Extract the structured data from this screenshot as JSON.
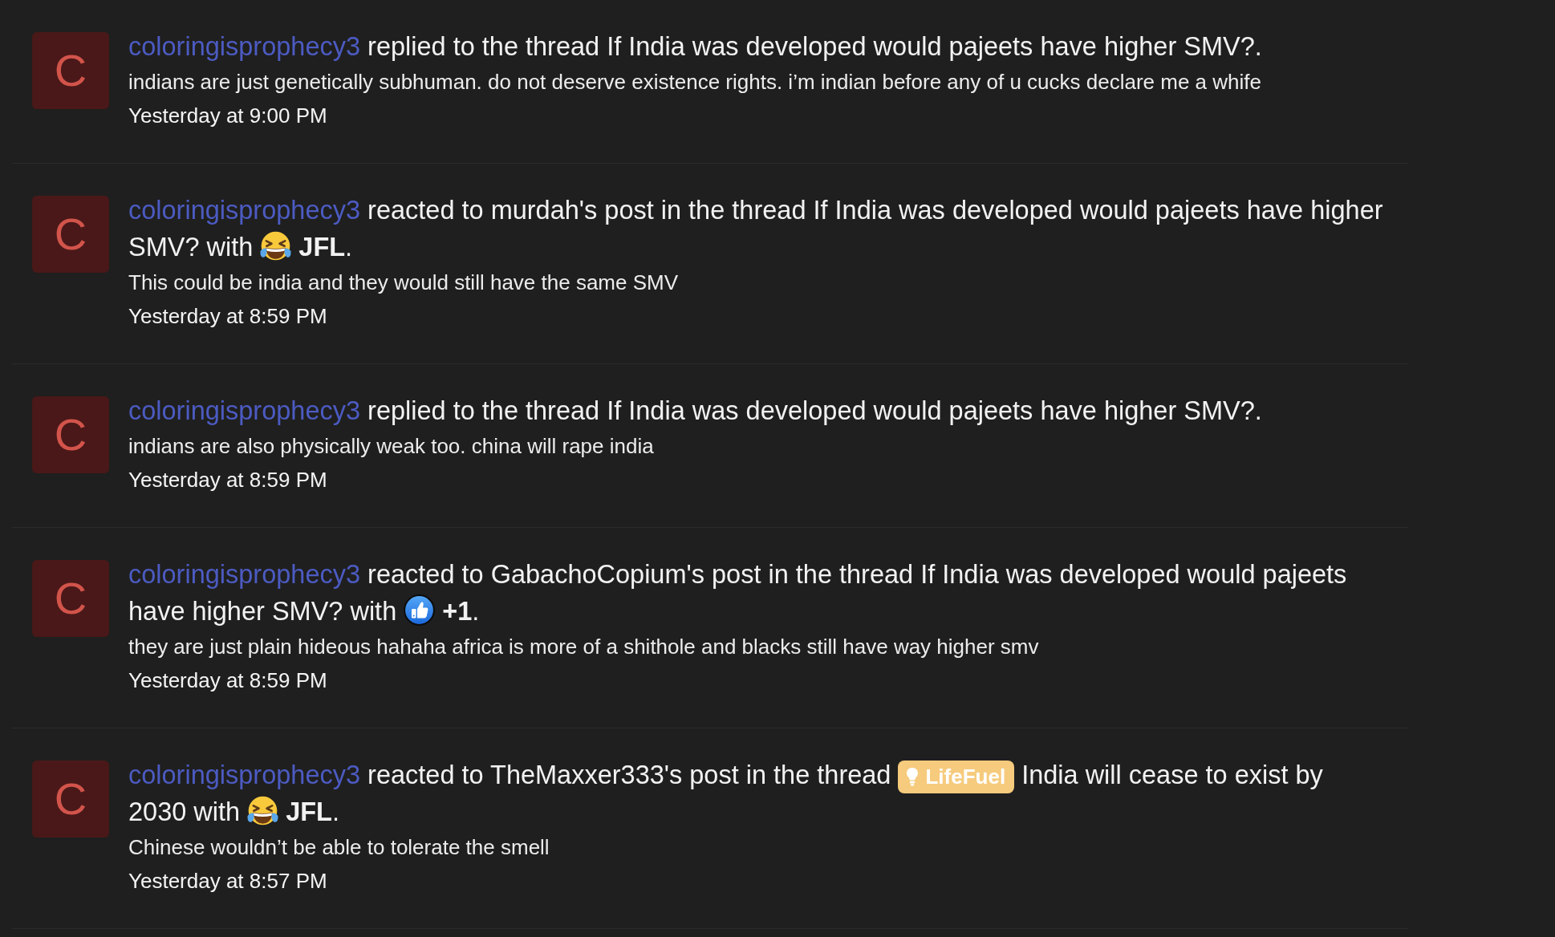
{
  "activity_feed": [
    {
      "avatar_letter": "C",
      "user": "coloringisprophecy3",
      "headline": [
        {
          "kind": "text",
          "text": "replied to the thread If India was developed would pajeets have higher SMV?."
        }
      ],
      "snippet": "indians are just genetically subhuman. do not deserve existence rights. i’m indian before any of u cucks declare me a whife",
      "time": "Yesterday at 9:00 PM"
    },
    {
      "avatar_letter": "C",
      "user": "coloringisprophecy3",
      "headline": [
        {
          "kind": "text",
          "text": "reacted to murdah's post in the thread If India was developed would pajeets have higher SMV? with"
        },
        {
          "kind": "laugh"
        },
        {
          "kind": "text",
          "text": "**JFL**."
        }
      ],
      "snippet": "This could be india and they would still have the same SMV",
      "time": "Yesterday at 8:59 PM"
    },
    {
      "avatar_letter": "C",
      "user": "coloringisprophecy3",
      "headline": [
        {
          "kind": "text",
          "text": "replied to the thread If India was developed would pajeets have higher SMV?."
        }
      ],
      "snippet": "indians are also physically weak too. china will rape india",
      "time": "Yesterday at 8:59 PM"
    },
    {
      "avatar_letter": "C",
      "user": "coloringisprophecy3",
      "headline": [
        {
          "kind": "text",
          "text": "reacted to GabachoCopium's post in the thread If India was developed would pajeets have higher SMV? with"
        },
        {
          "kind": "like"
        },
        {
          "kind": "text",
          "text": "**+1**."
        }
      ],
      "snippet": "they are just plain hideous hahaha africa is more of a shithole and blacks still have way higher smv",
      "time": "Yesterday at 8:59 PM"
    },
    {
      "avatar_letter": "C",
      "user": "coloringisprophecy3",
      "headline": [
        {
          "kind": "text",
          "text": "reacted to TheMaxxer333's post in the thread"
        },
        {
          "kind": "prefix",
          "text": "LifeFuel"
        },
        {
          "kind": "text",
          "text": "India will cease to exist by 2030 with"
        },
        {
          "kind": "laugh"
        },
        {
          "kind": "text",
          "text": "**JFL**."
        }
      ],
      "snippet": "Chinese wouldn’t be able to tolerate the smell",
      "time": "Yesterday at 8:57 PM"
    }
  ]
}
